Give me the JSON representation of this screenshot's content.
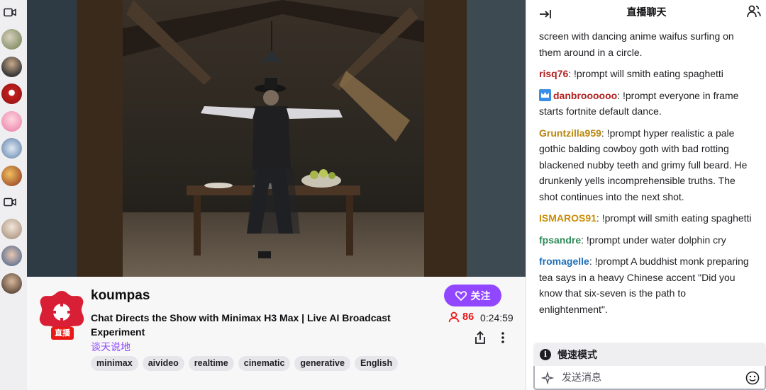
{
  "colors": {
    "accent": "#9147ff",
    "live": "#e91916",
    "rail_bg": "#efeff1"
  },
  "channel": {
    "name": "koumpas",
    "live_badge": "直播",
    "title": "Chat Directs the Show with Minimax H3 Max | Live AI Broadcast Experiment",
    "category": "谈天说地",
    "tags": [
      "minimax",
      "aivideo",
      "realtime",
      "cinematic",
      "generative",
      "English"
    ],
    "follow_label": "关注",
    "viewers": "86",
    "uptime": "0:24:59"
  },
  "chat": {
    "title": "直播聊天",
    "messages": [
      {
        "user": "",
        "text": "screen with dancing anime waifus surfing on them around in a circle.",
        "color": "#1f1f23"
      },
      {
        "user": "risq76",
        "text": ": !prompt will smith eating spaghetti",
        "color": "#b22222"
      },
      {
        "user": "danbroooooo",
        "text": ": !prompt everyone in frame starts fortnite default dance.",
        "color": "#b22222",
        "badge": "crown-icon"
      },
      {
        "user": "Gruntzilla959",
        "text": ": !prompt hyper realistic a pale gothic balding cowboy goth with bad rotting blackened nubby teeth and grimy full beard. He drunkenly yells incomprehensible truths. The shot continues into the next shot.",
        "color": "#b8860b"
      },
      {
        "user": "ISMAROS91",
        "text": ": !prompt will smith eating spaghetti",
        "color": "#c98d08"
      },
      {
        "user": "fpsandre",
        "text": ": !prompt under water dolphin cry",
        "color": "#2e8b57"
      },
      {
        "user": "fromagelle",
        "text": ": !prompt A buddhist monk preparing tea says in a heavy Chinese accent \"Did you know that six-seven is the path to enlightenment\".",
        "color": "#1e6fb8"
      }
    ],
    "slow_mode": "慢速模式",
    "input_placeholder": "发送消息"
  }
}
